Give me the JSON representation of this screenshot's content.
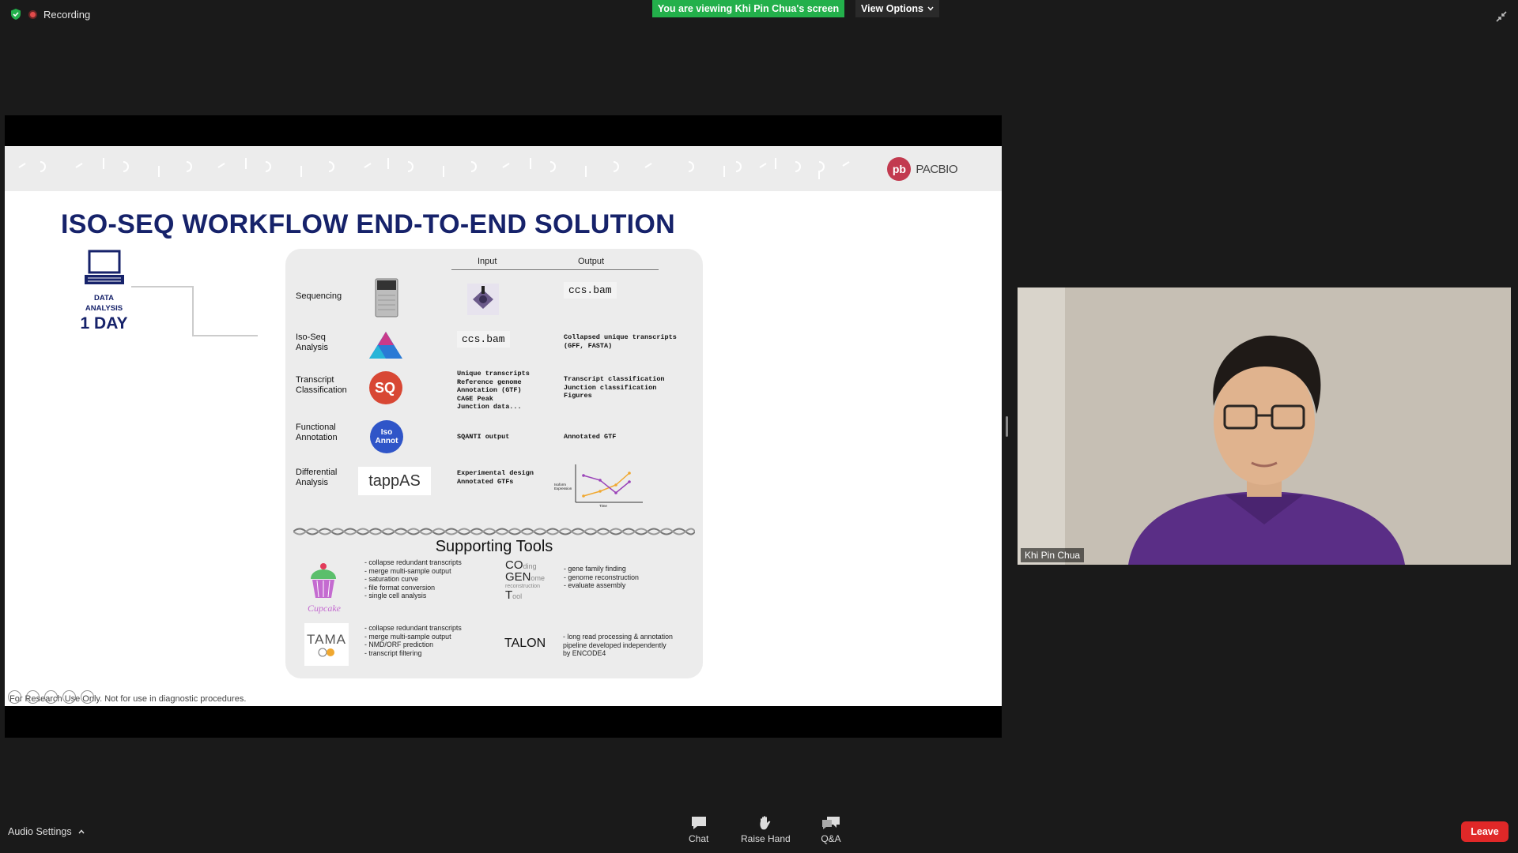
{
  "top_bar": {
    "recording_label": "Recording",
    "viewing_banner": "You are viewing Khi Pin Chua's screen",
    "view_options_label": "View Options"
  },
  "slide": {
    "brand": "PACBIO",
    "brand_mark": "pb",
    "title": "ISO-SEQ WORKFLOW END-TO-END SOLUTION",
    "data_analysis_line1": "DATA",
    "data_analysis_line2": "ANALYSIS",
    "duration": "1 DAY",
    "col_input": "Input",
    "col_output": "Output",
    "rows": [
      {
        "label_a": "Sequencing",
        "label_b": "",
        "output": "ccs.bam"
      },
      {
        "label_a": "Iso-Seq",
        "label_b": "Analysis",
        "input": "ccs.bam",
        "output": "Collapsed unique transcripts\n(GFF, FASTA)"
      },
      {
        "label_a": "Transcript",
        "label_b": "Classification",
        "input": "Unique transcripts\nReference genome\nAnnotation (GTF)\nCAGE Peak\nJunction data...",
        "output": "Transcript classification\nJunction classification\nFigures"
      },
      {
        "label_a": "Functional",
        "label_b": "Annotation",
        "input": "SQANTI output",
        "output": "Annotated GTF"
      },
      {
        "label_a": "Differential",
        "label_b": "Analysis",
        "input": "Experimental design\nAnnotated GTFs",
        "output": ""
      }
    ],
    "isoannot_label_1": "Iso",
    "isoannot_label_2": "Annot",
    "tappas_label": "tappAS",
    "chart_ylabel": "Isoform\nExpression",
    "chart_xlabel": "Time",
    "supporting_title": "Supporting Tools",
    "cupcake_name": "Cupcake",
    "cupcake_bullets": "- collapse redundant transcripts\n- merge multi-sample output\n- saturation curve\n- file format conversion\n- single cell analysis",
    "cogent_name_1": "CO",
    "cogent_name_2": "GEN",
    "cogent_name_3": "T",
    "cogent_small_1": "ding",
    "cogent_small_2": "ome",
    "cogent_small_3": "reconstruction",
    "cogent_small_4": "ool",
    "cogent_bullets": "- gene family finding\n- genome reconstruction\n- evaluate assembly",
    "tama_name": "TAMA",
    "tama_bullets": "- collapse redundant transcripts\n- merge multi-sample output\n- NMD/ORF prediction\n- transcript filtering",
    "talon_name": "TALON",
    "talon_bullets": "- long read processing & annotation\npipeline developed independently\nby ENCODE4",
    "footer": "For Research Use Only. Not for use in diagnostic procedures."
  },
  "video": {
    "participant_name": "Khi Pin Chua"
  },
  "bottom_bar": {
    "audio_settings": "Audio Settings",
    "chat": "Chat",
    "raise_hand": "Raise Hand",
    "qa": "Q&A",
    "leave": "Leave"
  },
  "colors": {
    "banner_green": "#23b04b",
    "leave_red": "#e02828",
    "title_navy": "#16226a",
    "pacbio_red": "#c23a4f"
  }
}
